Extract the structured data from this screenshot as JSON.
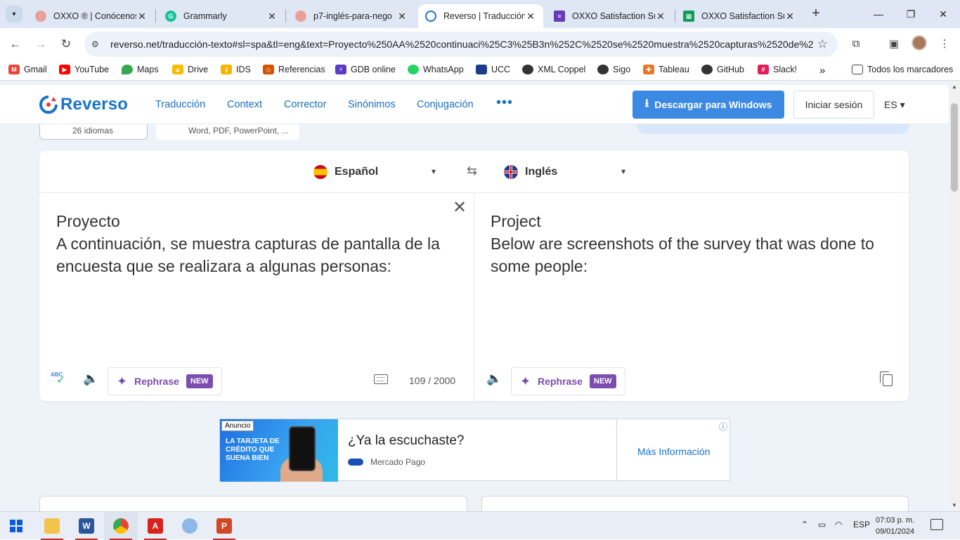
{
  "browser": {
    "tabs": [
      {
        "title": "OXXO ® | Conócenos",
        "active": false,
        "favicon_color": "#e8a09a"
      },
      {
        "title": "Grammarly",
        "active": false,
        "favicon_color": "#15c39a"
      },
      {
        "title": "p7-inglés-para-nego",
        "active": false,
        "favicon_color": "#e8a09a"
      },
      {
        "title": "Reverso | Traducción",
        "active": true,
        "favicon_color": "#1a73c8"
      },
      {
        "title": "OXXO Satisfaction Su",
        "active": false,
        "favicon_color": "#673ab7"
      },
      {
        "title": "OXXO Satisfaction Su",
        "active": false,
        "favicon_color": "#0f9d58"
      }
    ],
    "url": "reverso.net/traducción-texto#sl=spa&tl=eng&text=Proyecto%250AA%2520continuaci%25C3%25B3n%252C%2520se%2520muestra%2520capturas%2520de%2..."
  },
  "bookmarks": [
    {
      "label": "Gmail",
      "color": "#ea4335"
    },
    {
      "label": "YouTube",
      "color": "#ff0000"
    },
    {
      "label": "Maps",
      "color": "#34a853"
    },
    {
      "label": "Drive",
      "color": "#fbbc04"
    },
    {
      "label": "IDS",
      "color": "#f4b400"
    },
    {
      "label": "Referencias",
      "color": "#d35400"
    },
    {
      "label": "GDB online",
      "color": "#5b3cc4"
    },
    {
      "label": "WhatsApp",
      "color": "#25d366"
    },
    {
      "label": "UCC",
      "color": "#1a3e8c"
    },
    {
      "label": "XML Coppel",
      "color": "#333333"
    },
    {
      "label": "Sigo",
      "color": "#333333"
    },
    {
      "label": "Tableau",
      "color": "#e97627"
    },
    {
      "label": "GitHub",
      "color": "#333333"
    },
    {
      "label": "Slack!",
      "color": "#e01e5a"
    }
  ],
  "bookmarks_more": "»",
  "bookmarks_all": "Todos los marcadores",
  "reverso": {
    "logo": "Reverso",
    "nav": [
      "Traducción",
      "Context",
      "Corrector",
      "Sinónimos",
      "Conjugación"
    ],
    "nav_more": "•••",
    "download": "Descargar para Windows",
    "login": "Iniciar sesión",
    "lang": "ES ▾",
    "stub1": "26 idiomas",
    "stub2": "Word, PDF, PowerPoint, ...",
    "source_lang": "Español",
    "target_lang": "Inglés",
    "source_text": "Proyecto\nA continuación, se muestra capturas de pantalla de la encuesta que se realizara a algunas personas:",
    "target_text": "Project\nBelow are screenshots of the survey that was done to some people:",
    "rephrase": "Rephrase",
    "new_badge": "NEW",
    "char_count": "109 / 2000"
  },
  "ad": {
    "tag": "Anuncio",
    "image_copy": "LA TARJETA DE CRÉDITO QUE SUENA BIEN",
    "title": "¿Ya la escuchaste?",
    "brand": "Mercado Pago",
    "cta": "Más Información",
    "info": "ⓘ"
  },
  "taskbar": {
    "lang": "ESP",
    "time": "07:03 p. m.",
    "date": "09/01/2024"
  }
}
